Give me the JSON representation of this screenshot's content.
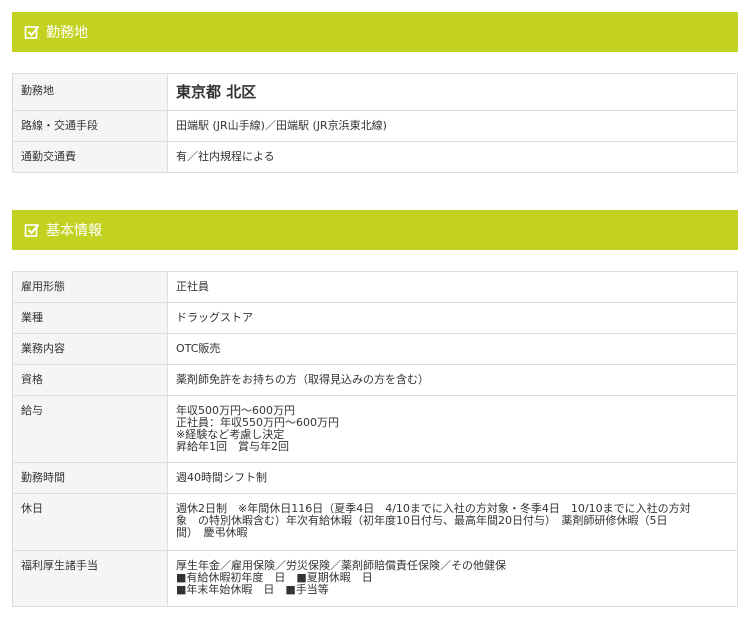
{
  "sections": {
    "work_location": {
      "title": "勤務地",
      "rows": [
        {
          "label": "勤務地",
          "value": "東京都 北区"
        },
        {
          "label": "路線・交通手段",
          "value": "田端駅 (JR山手線)／田端駅 (JR京浜東北線)"
        },
        {
          "label": "通勤交通費",
          "value": "有／社内規程による"
        }
      ]
    },
    "basic_info": {
      "title": "基本情報",
      "rows": [
        {
          "label": "雇用形態",
          "value": "正社員"
        },
        {
          "label": "業種",
          "value": "ドラッグストア"
        },
        {
          "label": "業務内容",
          "value": "OTC販売"
        },
        {
          "label": "資格",
          "value": "薬剤師免許をお持ちの方（取得見込みの方を含む）"
        },
        {
          "label": "給与",
          "lines": [
            "年収500万円～600万円",
            "正社員：年収550万円～600万円",
            "※経験など考慮し決定",
            "昇給年1回　賞与年2回"
          ]
        },
        {
          "label": "勤務時間",
          "value": "週40時間シフト制"
        },
        {
          "label": "休日",
          "lines": [
            "週休2日制　※年間休日116日（夏季4日　4/10までに入社の方対象・冬季4日　10/10までに入社の方対",
            "象　の特別休暇含む）年次有給休暇（初年度10日付与、最高年間20日付与）　薬剤師研修休暇（5日",
            "間）　慶弔休暇"
          ]
        },
        {
          "label": "福利厚生諸手当",
          "lines": [
            "厚生年金／雇用保険／労災保険／薬剤師賠償責任保険／その他健保",
            "■有給休暇初年度　日　■夏期休暇　日",
            "■年末年始休暇　日　■手当等"
          ]
        }
      ]
    }
  },
  "colors": {
    "header_bg": "#c3d221",
    "label_bg": "#f5f5f5",
    "border": "#dddddd"
  },
  "icons": {
    "section_icon": "checkbox-checked-icon"
  }
}
